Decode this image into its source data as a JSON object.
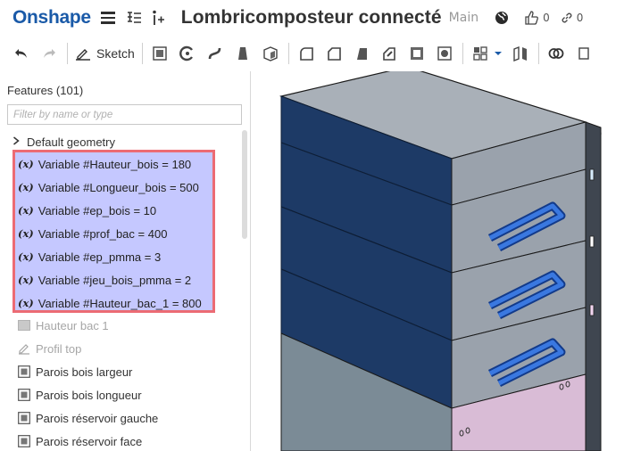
{
  "titlebar": {
    "logo": "Onshape",
    "document_title": "Lombricomposteur connecté",
    "branch": "Main",
    "likes_count": "0",
    "links_count": "0"
  },
  "toolbar": {
    "sketch_label": "Sketch"
  },
  "features": {
    "title": "Features (101)",
    "filter_placeholder": "Filter by name or type",
    "default_geometry": "Default geometry",
    "variables": [
      "Variable #Hauteur_bois = 180",
      "Variable #Longueur_bois = 500",
      "Variable #ep_bois = 10",
      "Variable #prof_bac = 400",
      "Variable #ep_pmma = 3",
      "Variable #jeu_bois_pmma = 2",
      "Variable #Hauteur_bac_1 = 800"
    ],
    "variable_icon_label": "(x)",
    "items": [
      {
        "label": "Hauteur bac 1",
        "state": "disabled"
      },
      {
        "label": "Profil top",
        "state": "disabled"
      },
      {
        "label": "Parois bois largeur",
        "state": "active"
      },
      {
        "label": "Parois bois longueur",
        "state": "active"
      },
      {
        "label": "Parois réservoir gauche",
        "state": "active"
      },
      {
        "label": "Parois réservoir face",
        "state": "active"
      }
    ]
  },
  "colors": {
    "brand": "#1a5aa8",
    "selection_fill": "#c5c8ff",
    "selection_border": "#ec6b74",
    "wood_dark": "#1d3a66",
    "wood_side": "#9aa2ac",
    "handle_blue": "#2a62c9",
    "pmma_pink": "#d9bcd6"
  }
}
